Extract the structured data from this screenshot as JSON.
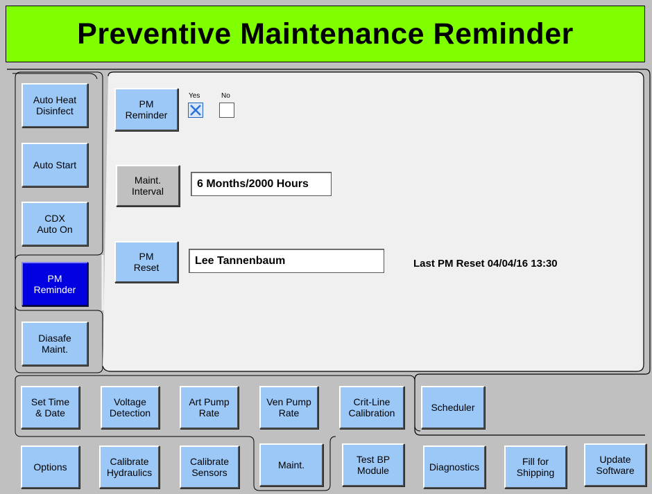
{
  "header": {
    "title": "Preventive Maintenance Reminder"
  },
  "left_tabs": [
    {
      "label": "Auto Heat\nDisinfect"
    },
    {
      "label": "Auto Start"
    },
    {
      "label": "CDX\nAuto On"
    },
    {
      "label": "PM\nReminder"
    },
    {
      "label": "Diasafe\nMaint."
    }
  ],
  "panel": {
    "pm_reminder_button": "PM\nReminder",
    "yes_label": "Yes",
    "no_label": "No",
    "yes_checked": true,
    "no_checked": false,
    "maint_interval_button": "Maint.\nInterval",
    "maint_interval_value": "6 Months/2000 Hours",
    "pm_reset_button": "PM\nReset",
    "pm_reset_name": "Lee Tannenbaum",
    "last_pm_reset_label": "Last PM Reset",
    "last_pm_reset_value": "04/04/16 13:30"
  },
  "row1_tabs": [
    {
      "label": "Set Time\n& Date"
    },
    {
      "label": "Voltage\nDetection"
    },
    {
      "label": "Art Pump\nRate"
    },
    {
      "label": "Ven Pump\nRate"
    },
    {
      "label": "Crit-Line\nCalibration"
    },
    {
      "label": "Scheduler"
    }
  ],
  "row2_tabs": [
    {
      "label": "Options"
    },
    {
      "label": "Calibrate\nHydraulics"
    },
    {
      "label": "Calibrate\nSensors"
    },
    {
      "label": "Maint."
    },
    {
      "label": "Test BP\nModule"
    },
    {
      "label": "Diagnostics"
    },
    {
      "label": "Fill for\nShipping"
    },
    {
      "label": "Update\nSoftware"
    }
  ],
  "colors": {
    "header_bg": "#80ff00",
    "button_bg": "#9cc8f8",
    "active_tab": "#0000e0",
    "panel_bg": "#f0f0f0"
  }
}
